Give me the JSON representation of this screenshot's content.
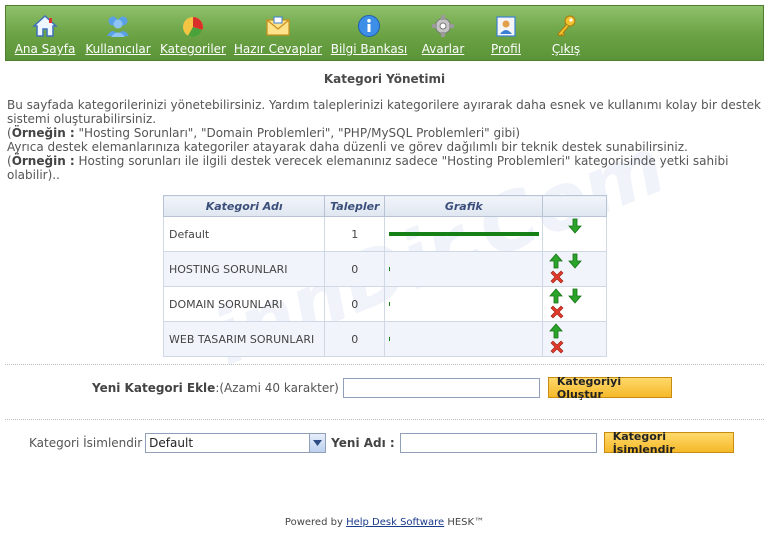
{
  "nav": {
    "items": [
      {
        "label": "Ana Sayfa",
        "icon": "home-icon"
      },
      {
        "label": "Kullanıcılar",
        "icon": "users-icon"
      },
      {
        "label": "Kategoriler",
        "icon": "pie-chart-icon"
      },
      {
        "label": "Hazır Cevaplar",
        "icon": "envelope-icon"
      },
      {
        "label": "Bilgi Bankası",
        "icon": "info-icon"
      },
      {
        "label": "Avarlar",
        "icon": "gear-icon"
      },
      {
        "label": "Profil",
        "icon": "profile-icon"
      },
      {
        "label": "Çıkış",
        "icon": "key-icon"
      }
    ]
  },
  "page_title": "Kategori Yönetimi",
  "intro": {
    "line1": "Bu sayfada kategorilerinizi yönetebilirsiniz. Yardım taleplerinizi kategorilere ayırarak daha esnek ve kullanımı kolay bir destek sistemi oluşturabilirsiniz.",
    "example_label": "Örneğin :",
    "example1": " \"Hosting Sorunları\", \"Domain Problemleri\", \"PHP/MySQL Problemleri\" gibi)",
    "line2": "Ayrıca destek elemanlarınıza kategoriler atayarak daha düzenli ve görev dağılımlı bir teknik destek sunabilirsiniz.",
    "example2": " Hosting sorunları ile ilgili destek verecek elemanınız sadece \"Hosting Problemleri\" kategorisinde yetki sahibi olabilir).."
  },
  "table": {
    "headers": {
      "name": "Kategori Adı",
      "count": "Talepler",
      "graph": "Grafik",
      "actions": ""
    },
    "rows": [
      {
        "name": "Default",
        "count": "1",
        "share": 1.0,
        "up": false,
        "down": true,
        "delete": false
      },
      {
        "name": "HOSTING SORUNLARI",
        "count": "0",
        "share": 0,
        "up": true,
        "down": true,
        "delete": true
      },
      {
        "name": "DOMAIN SORUNLARI",
        "count": "0",
        "share": 0,
        "up": true,
        "down": true,
        "delete": true
      },
      {
        "name": "WEB TASARIM SORUNLARI",
        "count": "0",
        "share": 0,
        "up": true,
        "down": false,
        "delete": true
      }
    ]
  },
  "new_category": {
    "label": "Yeni Kategori Ekle",
    "colon": ":",
    "hint": " (Azami 40 karakter)",
    "input_value": "",
    "button": "Kategoriyi Oluştur"
  },
  "rename": {
    "label": "Kategori İsimlendir",
    "selected": "Default",
    "new_name_label": "Yeni Adı :",
    "input_value": "",
    "button": "Kategori İsimlendir"
  },
  "footer": {
    "prefix": "Powered by ",
    "link": "Help Desk Software",
    "suffix": " HESK™"
  },
  "watermark": "innDir.Com",
  "colors": {
    "nav_bg": "#6aa244",
    "graph_bar": "#158015",
    "button": "#f5b92a",
    "up_arrow": "#1f9a1f",
    "down_arrow": "#1f9a1f",
    "delete": "#d63a2a"
  }
}
